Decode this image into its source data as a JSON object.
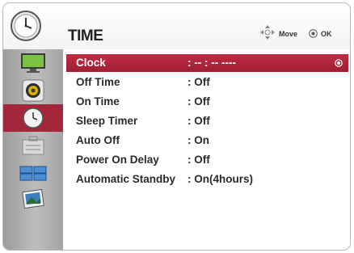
{
  "header": {
    "title": "TIME",
    "icon": "clock-icon",
    "hints": {
      "move_label": "Move",
      "ok_label": "OK"
    }
  },
  "sidebar": {
    "items": [
      {
        "name": "picture",
        "icon": "monitor-icon"
      },
      {
        "name": "audio",
        "icon": "speaker-icon"
      },
      {
        "name": "time",
        "icon": "clock-icon",
        "active": true
      },
      {
        "name": "option",
        "icon": "toolbox-icon"
      },
      {
        "name": "input",
        "icon": "input-screens-icon"
      },
      {
        "name": "my-media",
        "icon": "photo-media-icon"
      }
    ]
  },
  "menu": {
    "rows": [
      {
        "label": "Clock",
        "value": ": -- : -- ----",
        "selected": true
      },
      {
        "label": "Off Time",
        "value": ": Off"
      },
      {
        "label": "On Time",
        "value": ": Off"
      },
      {
        "label": "Sleep Timer",
        "value": ": Off"
      },
      {
        "label": "Auto Off",
        "value": ": On"
      },
      {
        "label": "Power On Delay",
        "value": ": Off"
      },
      {
        "label": "Automatic Standby",
        "value": ": On(4hours)"
      }
    ]
  },
  "colors": {
    "selected_row": "#b0253c",
    "sidebar_active": "#a4263a",
    "sidebar_bg": "#b0b0b0",
    "text": "#2a2a2a"
  }
}
